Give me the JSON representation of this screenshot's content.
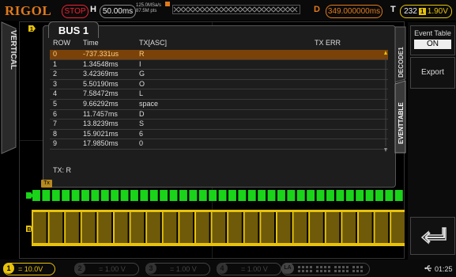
{
  "header": {
    "logo": "RIGOL",
    "run_state": "STOP",
    "timebase_label": "H",
    "timebase_value": "50.00ms",
    "sample_rate": "125.0MSa/s",
    "memory_depth": "87.5M pts",
    "delay_label": "D",
    "delay_value": "349.000000ms",
    "trigger_label": "T",
    "trigger_level_prefix": "232",
    "trigger_source": "1",
    "trigger_level": "1.90V"
  },
  "left_tab": {
    "label": "VERTICAL"
  },
  "decoder_panel": {
    "tab": "BUS 1",
    "columns": [
      "ROW",
      "Time",
      "TX[ASC]",
      "TX ERR"
    ],
    "rows": [
      {
        "row": "0",
        "time": "-737.331us",
        "tx": "R",
        "selected": true
      },
      {
        "row": "1",
        "time": "1.34548ms",
        "tx": "I"
      },
      {
        "row": "2",
        "time": "3.42369ms",
        "tx": "G"
      },
      {
        "row": "3",
        "time": "5.50190ms",
        "tx": "O"
      },
      {
        "row": "4",
        "time": "7.58472ms",
        "tx": "L"
      },
      {
        "row": "5",
        "time": "9.66292ms",
        "tx": "space"
      },
      {
        "row": "6",
        "time": "11.7457ms",
        "tx": "D"
      },
      {
        "row": "7",
        "time": "13.8239ms",
        "tx": "S"
      },
      {
        "row": "8",
        "time": "15.9021ms",
        "tx": "6"
      },
      {
        "row": "9",
        "time": "17.9850ms",
        "tx": "0"
      }
    ],
    "footer": "TX: R"
  },
  "right_tabs": [
    "DECODE1",
    "EVENTTABLE"
  ],
  "right_panel": {
    "event_table_title": "Event Table",
    "event_table_value": "ON",
    "export_label": "Export",
    "return_icon": "return-arrow-icon"
  },
  "waveform": {
    "tx_tag": "Tx",
    "bus_marker": "B",
    "channel_marker": "1"
  },
  "bottom": {
    "ch1": {
      "num": "1",
      "value": "10.0V"
    },
    "ch2": {
      "num": "2",
      "value": "1.00 V"
    },
    "ch3": {
      "num": "3",
      "value": "1.00 V"
    },
    "ch4": {
      "num": "4",
      "value": "1.00 V"
    },
    "la": {
      "label": "LA"
    },
    "time": "01:25"
  },
  "colors": {
    "accent": "#e07a1b",
    "ch1": "#e8c30b",
    "bus": "#19d419",
    "selected_row": "#7a4208"
  }
}
